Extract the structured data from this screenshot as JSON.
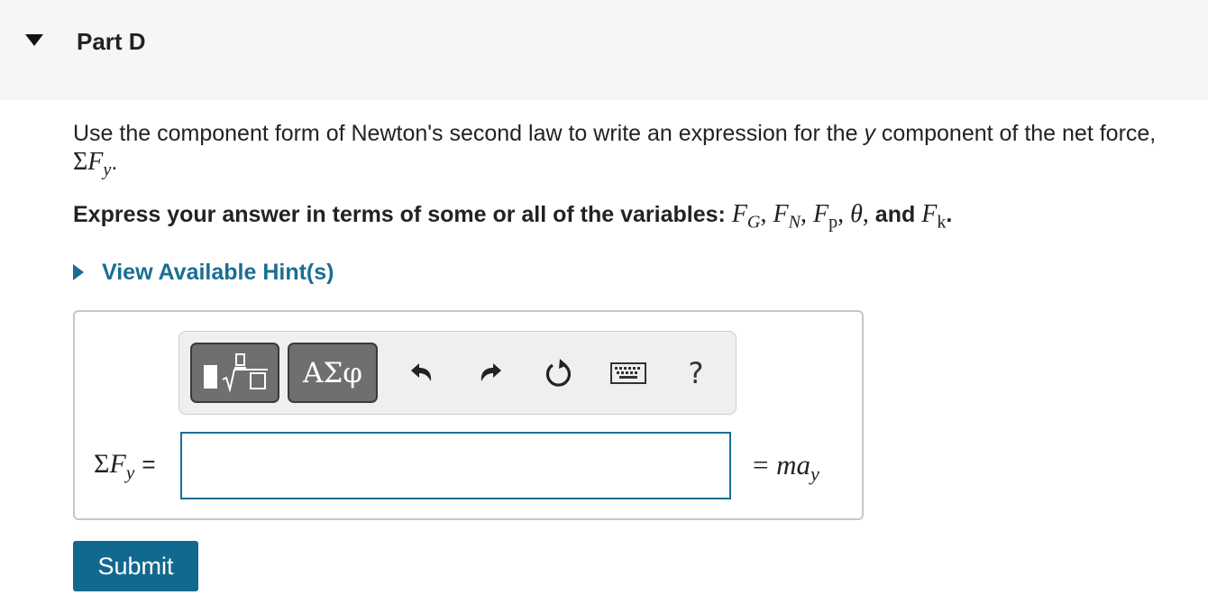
{
  "header": {
    "title": "Part D"
  },
  "question": {
    "text_before": "Use the component form of Newton's second law to write an expression for the ",
    "var_y": "y",
    "text_after": " component of the net force,",
    "sum_symbol": "Σ",
    "force_symbol": "F",
    "sub_y": "y",
    "end": "."
  },
  "express": {
    "lead": "Express your answer in terms of some or all of the variables: ",
    "variables": [
      {
        "base": "F",
        "sub": "G"
      },
      {
        "base": "F",
        "sub": "N"
      },
      {
        "base": "F",
        "sub": "p"
      },
      {
        "base": "θ",
        "sub": ""
      },
      {
        "base": "F",
        "sub": "k"
      }
    ],
    "comma": ",",
    "and": " and ",
    "end": "."
  },
  "hint": {
    "label": "View Available Hint(s)"
  },
  "toolbar": {
    "template_icon": "templates-fraction-sqrt-icon",
    "greek_label": "ΑΣφ",
    "undo_icon": "undo-icon",
    "redo_icon": "redo-icon",
    "reset_icon": "reset-icon",
    "keyboard_icon": "keyboard-icon",
    "help_label": "?"
  },
  "answer": {
    "lhs_sum": "Σ",
    "lhs_force": "F",
    "lhs_sub": "y",
    "lhs_equals": "=",
    "input_value": "",
    "rhs_equals": "=",
    "rhs_m": "m",
    "rhs_a": "a",
    "rhs_sub": "y"
  },
  "submit": {
    "label": "Submit"
  },
  "colors": {
    "accent": "#1a6e92",
    "submit_bg": "#12698f",
    "header_bg": "#f6f6f6",
    "toolbar_button": "#6f6f6f"
  }
}
